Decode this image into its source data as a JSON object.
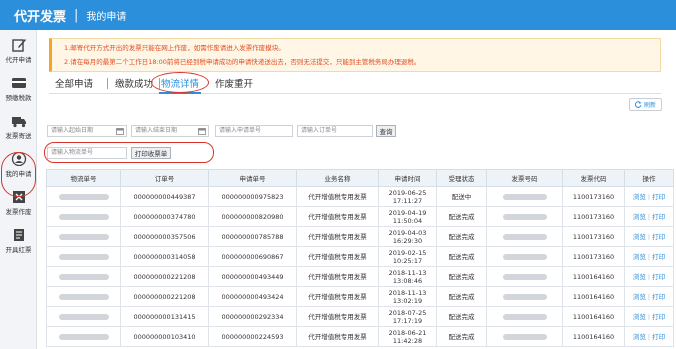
{
  "header": {
    "app_title": "代开发票",
    "separator": "|",
    "page_title": "我的申请"
  },
  "sidebar": {
    "items": [
      {
        "label": "代开申请",
        "icon": "edit-icon"
      },
      {
        "label": "预缴税款",
        "icon": "card-icon"
      },
      {
        "label": "发票寄送",
        "icon": "truck-icon"
      },
      {
        "label": "我的申请",
        "icon": "user-icon"
      },
      {
        "label": "发票作废",
        "icon": "void-icon"
      },
      {
        "label": "开具红票",
        "icon": "document-icon"
      }
    ]
  },
  "notice": {
    "line1": "1.邮寄代开方式开出的发票只能在网上作废，如需作废请进入发票作废模块。",
    "line2": "2.请在每月的最第二个工作日18:00前将已经到税申请成功的申请快递送出去，否则无法提交，只能到主管税务局办理退税。"
  },
  "tabs": [
    "全部申请",
    "缴款成功",
    "物流详情",
    "作废重开"
  ],
  "refresh_label": "刷新",
  "filters": {
    "start_date": "请输入起始日期",
    "end_date": "请输入结束日期",
    "apply_no": "请输入申请单号",
    "order_no": "请输入订单号",
    "search_btn": "查询",
    "logistics_no": "请输入物流单号",
    "print_btn": "打印收票单"
  },
  "table": {
    "columns": [
      "物流单号",
      "订单号",
      "申请单号",
      "业务名称",
      "申请时间",
      "受理状态",
      "发票号码",
      "发票代码",
      "操作"
    ],
    "action_view": "浏览",
    "action_sep": "|",
    "action_print": "打印",
    "rows": [
      {
        "order": "000000000449387",
        "apply": "000000000975823",
        "biz": "代开增值税专用发票",
        "date": "2019-06-25",
        "time": "17:11:27",
        "status": "配送中",
        "code": "1100173160"
      },
      {
        "order": "000000000374780",
        "apply": "000000000820980",
        "biz": "代开增值税专用发票",
        "date": "2019-04-19",
        "time": "11:50:04",
        "status": "配送完成",
        "code": "1100173160"
      },
      {
        "order": "000000000357506",
        "apply": "000000000785788",
        "biz": "代开增值税专用发票",
        "date": "2019-04-03",
        "time": "16:29:30",
        "status": "配送完成",
        "code": "1100173160"
      },
      {
        "order": "000000000314058",
        "apply": "000000000690867",
        "biz": "代开增值税专用发票",
        "date": "2019-02-15",
        "time": "10:25:17",
        "status": "配送完成",
        "code": "1100173160"
      },
      {
        "order": "000000000221208",
        "apply": "000000000493449",
        "biz": "代开增值税专用发票",
        "date": "2018-11-13",
        "time": "13:08:46",
        "status": "配送完成",
        "code": "1100164160"
      },
      {
        "order": "000000000221208",
        "apply": "000000000493424",
        "biz": "代开增值税专用发票",
        "date": "2018-11-13",
        "time": "13:02:19",
        "status": "配送完成",
        "code": "1100164160"
      },
      {
        "order": "000000000131415",
        "apply": "000000000292334",
        "biz": "代开增值税专用发票",
        "date": "2018-07-25",
        "time": "17:17:19",
        "status": "配送完成",
        "code": "1100164160"
      },
      {
        "order": "000000000103410",
        "apply": "000000000224593",
        "biz": "代开增值税专用发票",
        "date": "2018-06-21",
        "time": "11:42:28",
        "status": "配送完成",
        "code": "1100164160"
      }
    ]
  }
}
